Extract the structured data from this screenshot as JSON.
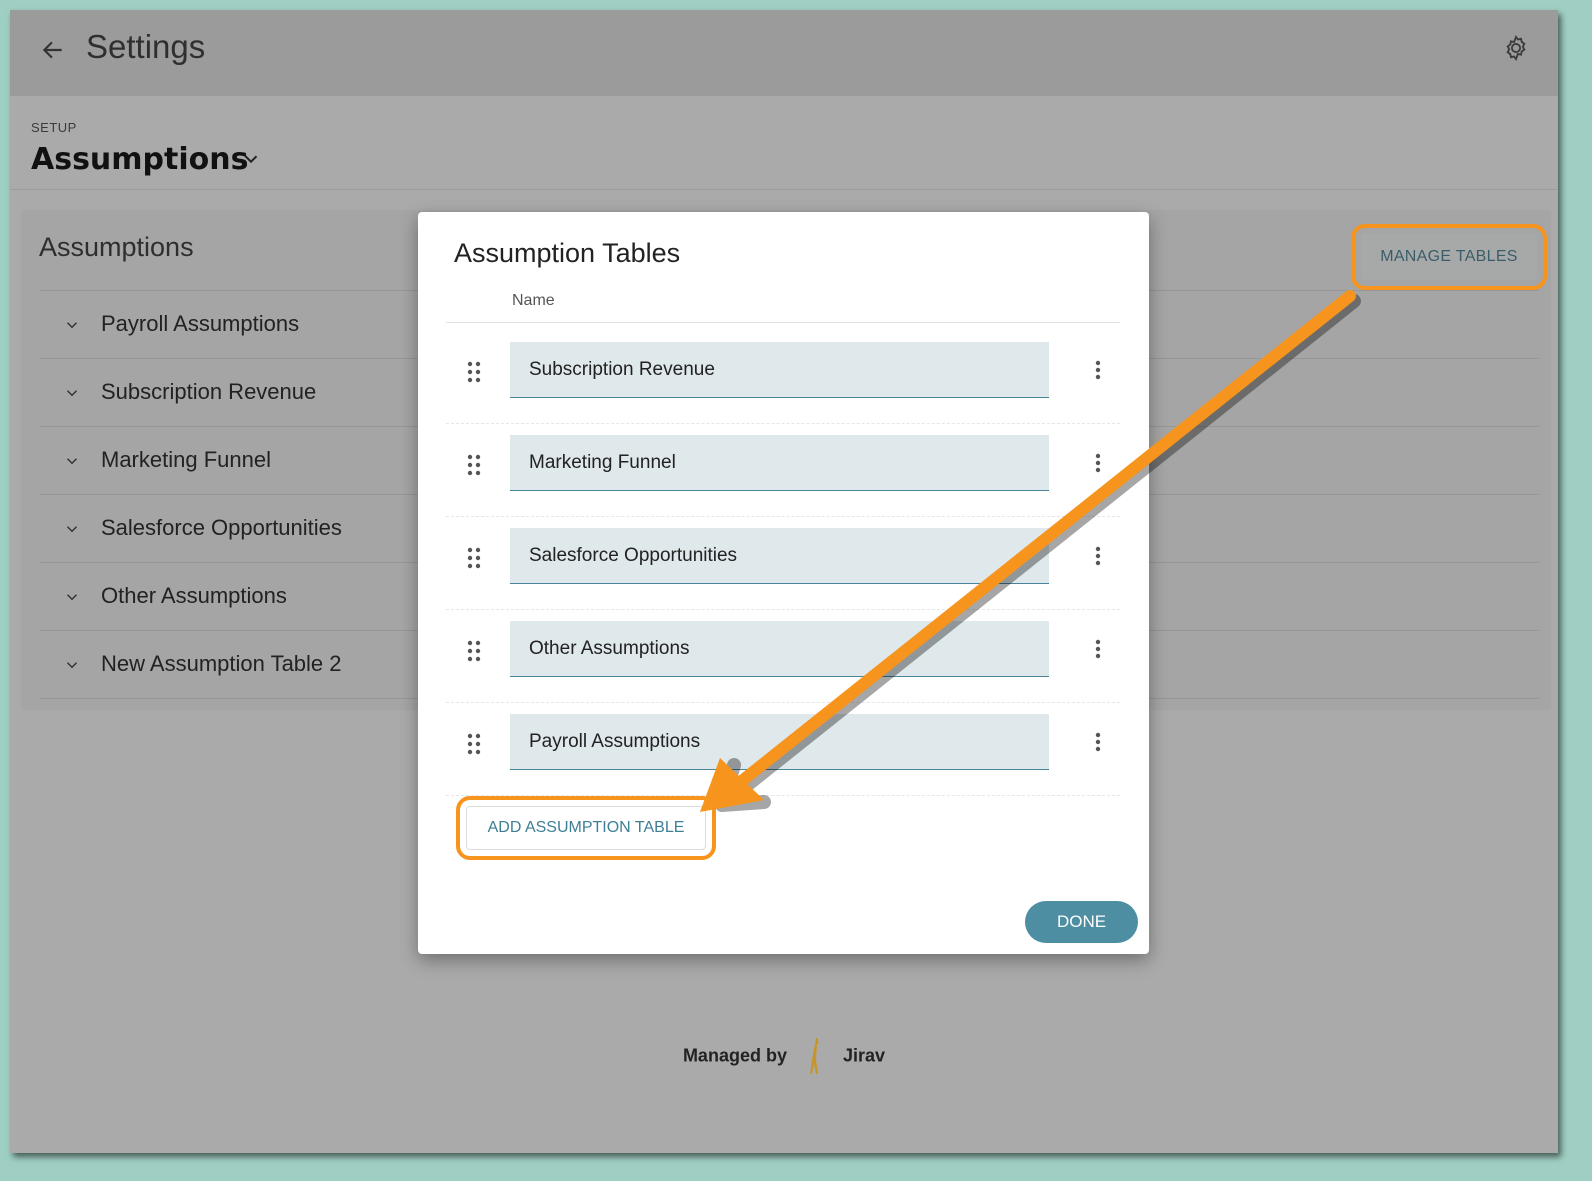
{
  "header": {
    "title": "Settings"
  },
  "setup": {
    "label": "SETUP",
    "title": "Assumptions"
  },
  "panel": {
    "title": "Assumptions",
    "manage_label": "MANAGE TABLES",
    "items": [
      {
        "label": "Payroll Assumptions"
      },
      {
        "label": "Subscription Revenue"
      },
      {
        "label": "Marketing Funnel"
      },
      {
        "label": "Salesforce Opportunities"
      },
      {
        "label": "Other Assumptions"
      },
      {
        "label": "New Assumption Table 2"
      }
    ]
  },
  "modal": {
    "title": "Assumption Tables",
    "column_header": "Name",
    "rows": [
      {
        "value": "Subscription Revenue"
      },
      {
        "value": "Marketing Funnel"
      },
      {
        "value": "Salesforce Opportunities"
      },
      {
        "value": "Other Assumptions"
      },
      {
        "value": "Payroll Assumptions"
      }
    ],
    "add_label": "ADD ASSUMPTION TABLE",
    "done_label": "DONE"
  },
  "footer": {
    "managed_by": "Managed by",
    "brand": "Jirav"
  },
  "colors": {
    "highlight": "#f7941d",
    "accent": "#4d8ea3",
    "input_bg": "#dfe8eb"
  },
  "icons": [
    "back-arrow-icon",
    "gear-icon",
    "chevron-down-icon",
    "drag-handle-icon",
    "kebab-menu-icon",
    "giraffe-logo-icon"
  ]
}
